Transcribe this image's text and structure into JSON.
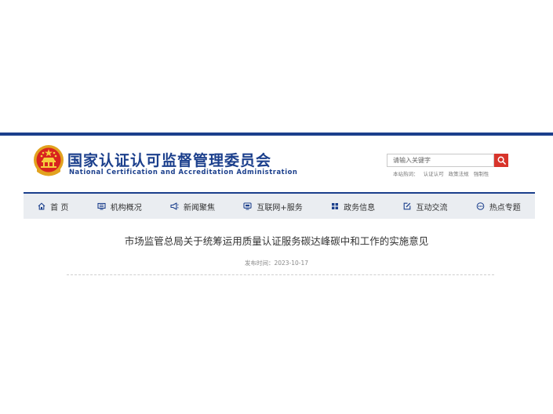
{
  "header": {
    "title_cn": "国家认证认可监督管理委员会",
    "title_en": "National Certification and Accreditation Administration",
    "emblem_icon": "national-emblem-icon",
    "accent_color": "#1b3f8c"
  },
  "search": {
    "placeholder": "请输入关键字",
    "button_icon": "search-icon",
    "button_color": "#d8342b",
    "hot_label": "本站热词：",
    "hot_words": [
      "认证认可",
      "政策法规",
      "强制性"
    ]
  },
  "nav": {
    "items": [
      {
        "label": "首 页",
        "icon": "home-icon"
      },
      {
        "label": "机构概况",
        "icon": "monitor-icon"
      },
      {
        "label": "新闻聚焦",
        "icon": "megaphone-icon"
      },
      {
        "label": "互联网+服务",
        "icon": "screen-icon"
      },
      {
        "label": "政务信息",
        "icon": "grid-icon"
      },
      {
        "label": "互动交流",
        "icon": "edit-icon"
      },
      {
        "label": "热点专题",
        "icon": "dots-icon"
      }
    ]
  },
  "article": {
    "title": "市场监管总局关于统筹运用质量认证服务碳达峰碳中和工作的实施意见",
    "publish_time": "发布时间：2023-10-17"
  }
}
